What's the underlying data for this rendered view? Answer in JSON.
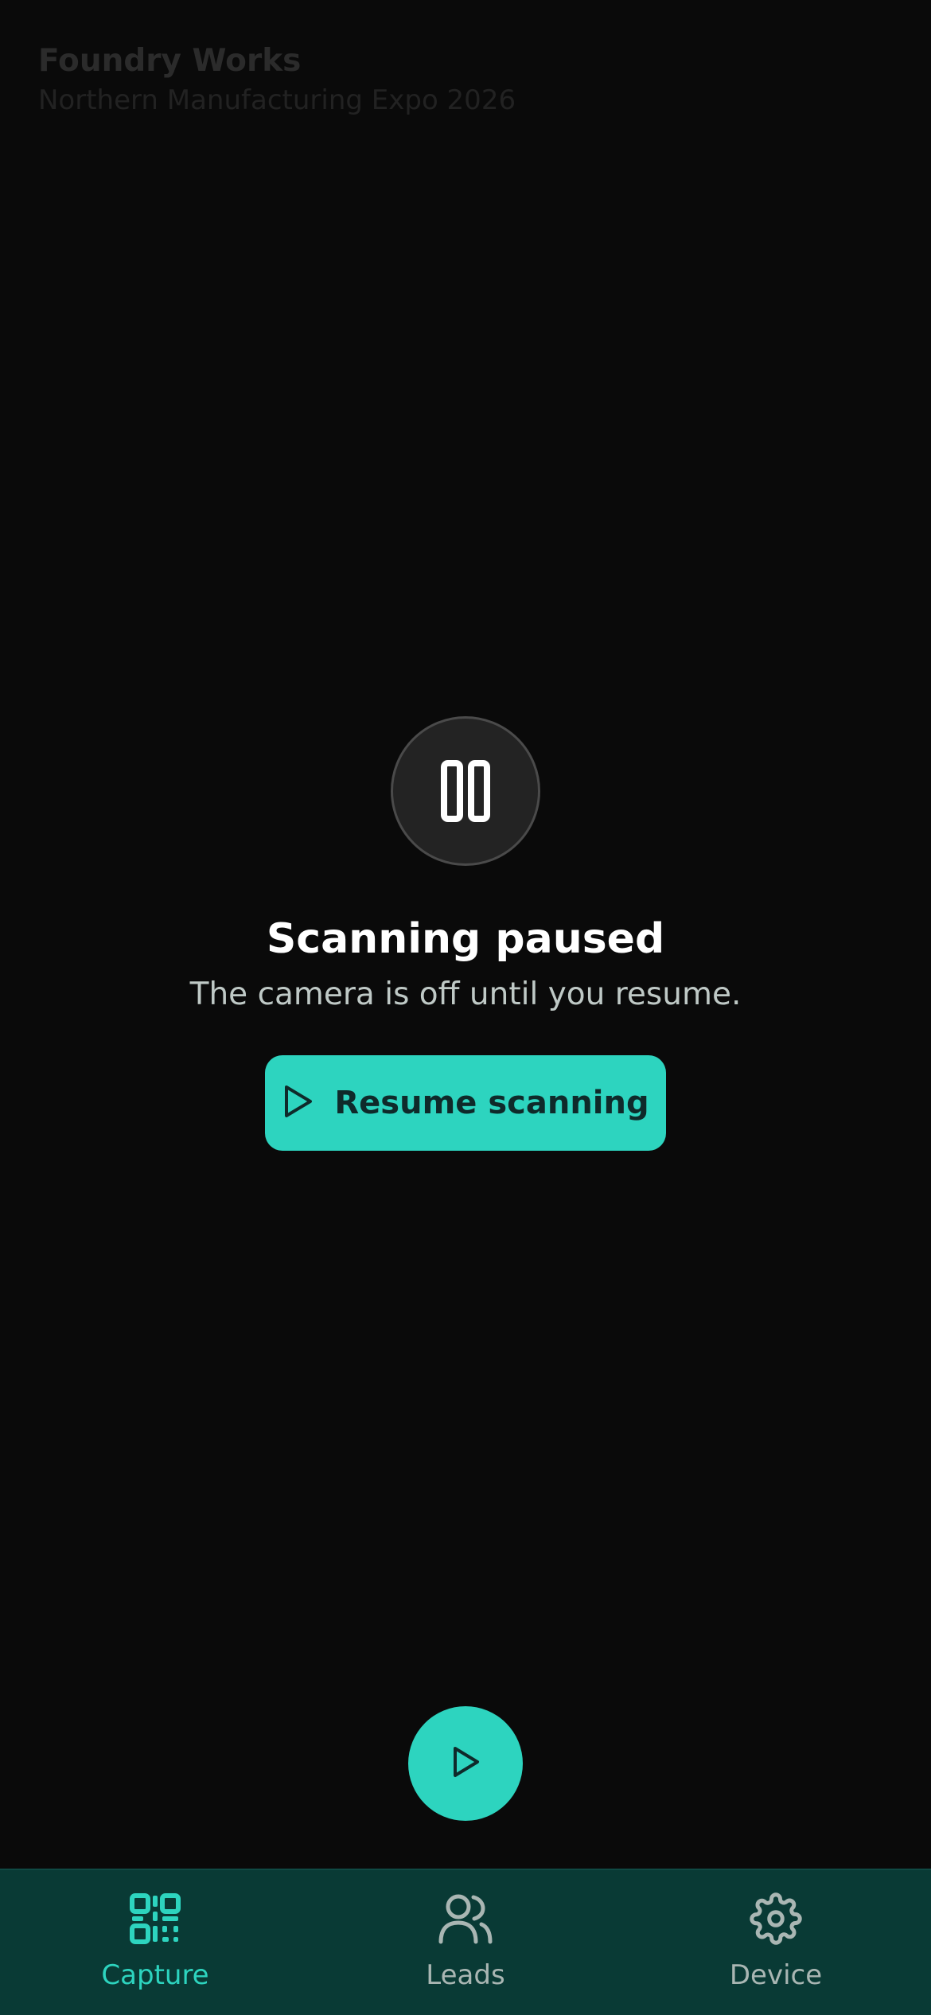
{
  "header": {
    "brand": "Foundry Works",
    "event": "Northern Manufacturing Expo 2026"
  },
  "paused": {
    "icon": "pause-icon",
    "title": "Scanning paused",
    "subtitle": "The camera is off until you resume.",
    "resume_label": "Resume scanning",
    "resume_icon": "play-icon"
  },
  "fab": {
    "icon": "play-icon"
  },
  "tabs": [
    {
      "label": "Capture",
      "icon": "qr-code-icon",
      "active": true
    },
    {
      "label": "Leads",
      "icon": "users-icon",
      "active": false
    },
    {
      "label": "Device",
      "icon": "gear-icon",
      "active": false
    }
  ],
  "colors": {
    "accent": "#2dd4bf",
    "background": "#0a0a0a",
    "tabbar": "#093a35",
    "inactive_tab": "#a9b6b3"
  }
}
